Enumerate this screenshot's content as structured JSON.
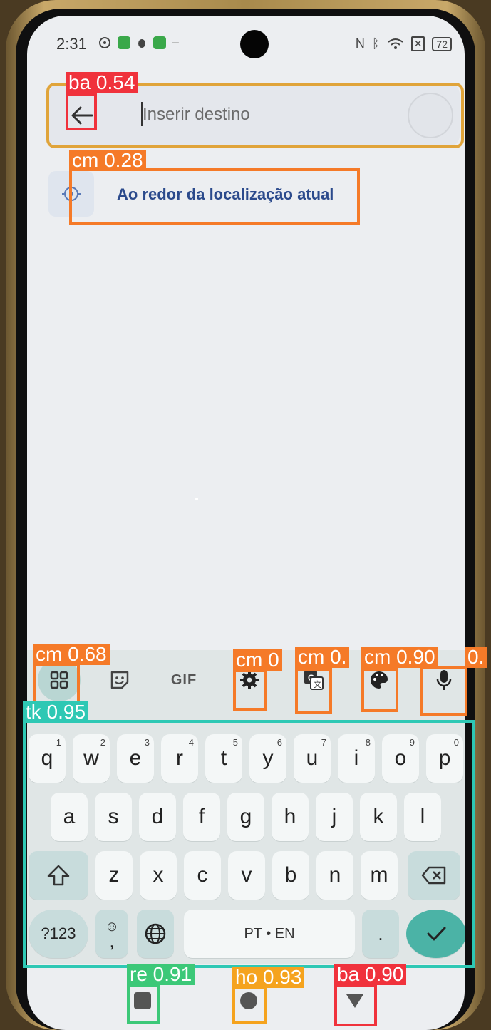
{
  "status_bar": {
    "time": "2:31",
    "battery": "72"
  },
  "search": {
    "placeholder": "Inserir destino"
  },
  "location_suggestion": {
    "label": "Ao redor da localização atual"
  },
  "keyboard": {
    "toolbar": {
      "gif_label": "GIF"
    },
    "row1": [
      {
        "key": "q",
        "sub": "1"
      },
      {
        "key": "w",
        "sub": "2"
      },
      {
        "key": "e",
        "sub": "3"
      },
      {
        "key": "r",
        "sub": "4"
      },
      {
        "key": "t",
        "sub": "5"
      },
      {
        "key": "y",
        "sub": "6"
      },
      {
        "key": "u",
        "sub": "7"
      },
      {
        "key": "i",
        "sub": "8"
      },
      {
        "key": "o",
        "sub": "9"
      },
      {
        "key": "p",
        "sub": "0"
      }
    ],
    "row2": [
      "a",
      "s",
      "d",
      "f",
      "g",
      "h",
      "j",
      "k",
      "l"
    ],
    "row3": [
      "z",
      "x",
      "c",
      "v",
      "b",
      "n",
      "m"
    ],
    "row4": {
      "symbols": "?123",
      "emoji_comma": ",",
      "space": "PT • EN",
      "period": "."
    }
  },
  "detections": [
    {
      "label": "ba 0.54",
      "color": "#f0323c"
    },
    {
      "label": "cm 0.28",
      "color": "#f57a28"
    },
    {
      "label": "cm 0.68",
      "color": "#f57a28"
    },
    {
      "label": "cm 0",
      "color": "#f57a28"
    },
    {
      "label": "cm 0.",
      "color": "#f57a28"
    },
    {
      "label": "cm 0.90",
      "color": "#f57a28"
    },
    {
      "label": "0.",
      "color": "#f57a28"
    },
    {
      "label": "tk 0.95",
      "color": "#2ec8b4"
    },
    {
      "label": "re 0.91",
      "color": "#3cc878"
    },
    {
      "label": "ho 0.93",
      "color": "#f5a31e"
    },
    {
      "label": "ba 0.90",
      "color": "#f0323c"
    }
  ],
  "search_bar_box_color": "#e0a43a"
}
